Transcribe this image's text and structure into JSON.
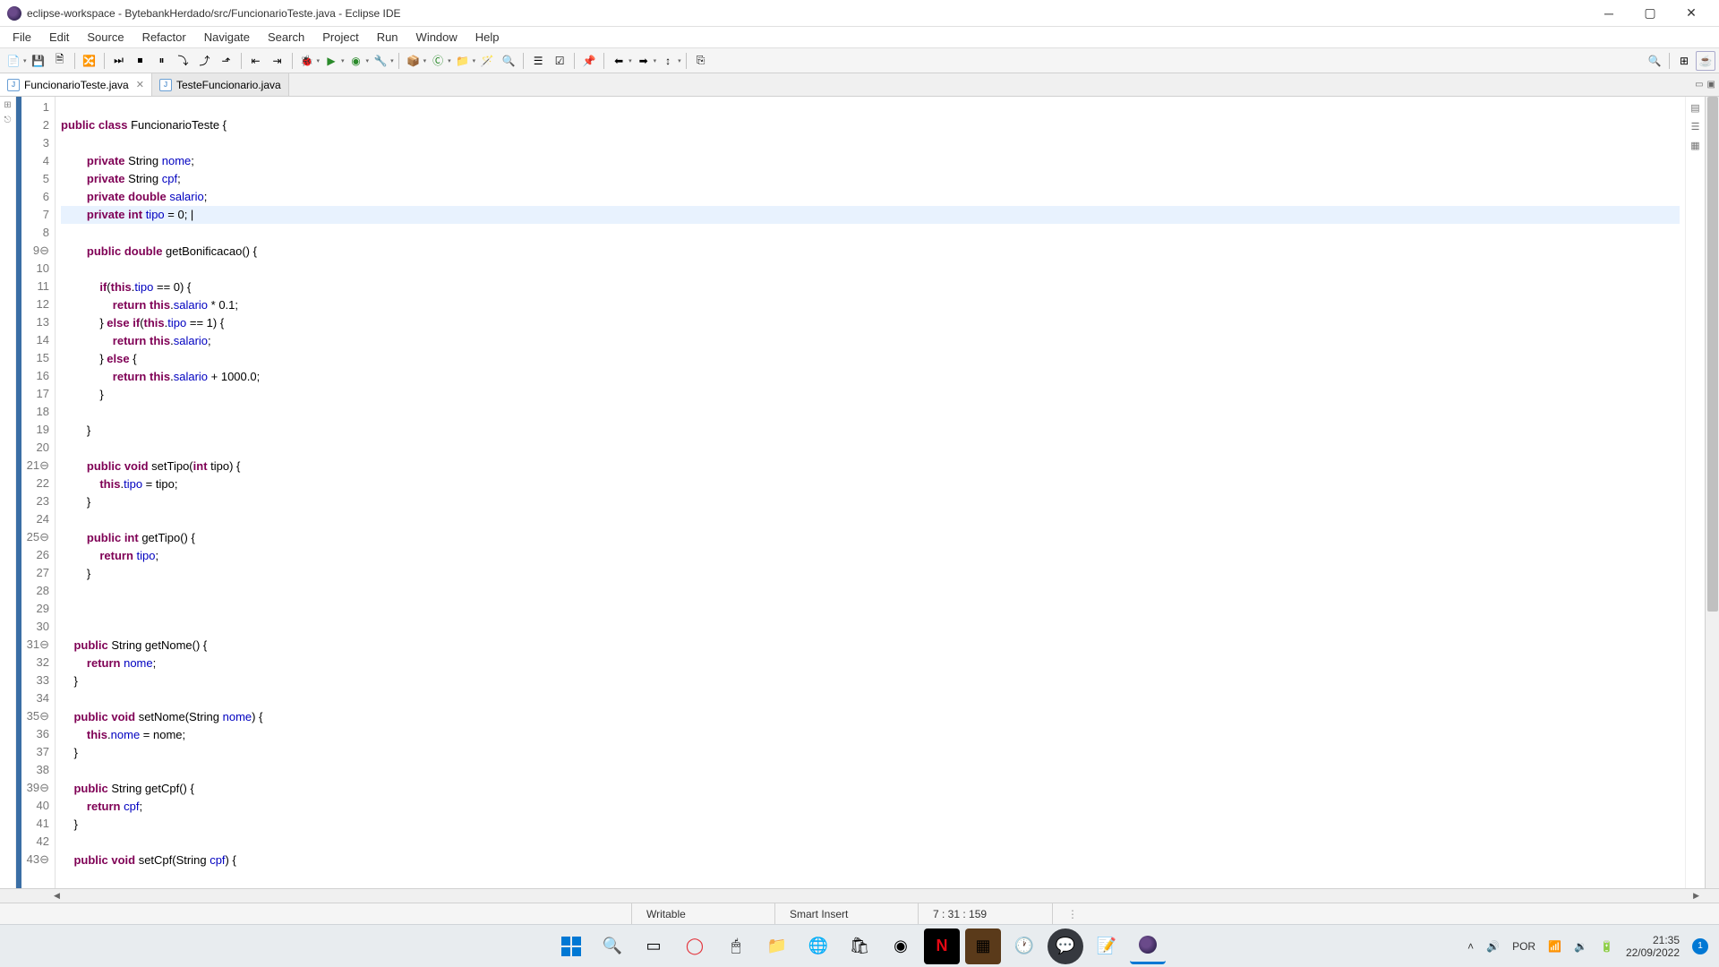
{
  "window": {
    "title": "eclipse-workspace - BytebankHerdado/src/FuncionarioTeste.java - Eclipse IDE"
  },
  "menu": {
    "items": [
      "File",
      "Edit",
      "Source",
      "Refactor",
      "Navigate",
      "Search",
      "Project",
      "Run",
      "Window",
      "Help"
    ]
  },
  "tabs": [
    {
      "label": "FuncionarioTeste.java",
      "active": true
    },
    {
      "label": "TesteFuncionario.java",
      "active": false
    }
  ],
  "editor": {
    "line_numbers": [
      "1",
      "2",
      "3",
      "4",
      "5",
      "6",
      "7",
      "8",
      "9⊖",
      "10",
      "11",
      "12",
      "13",
      "14",
      "15",
      "16",
      "17",
      "18",
      "19",
      "20",
      "21⊖",
      "22",
      "23",
      "24",
      "25⊖",
      "26",
      "27",
      "28",
      "29",
      "30",
      "31⊖",
      "32",
      "33",
      "34",
      "35⊖",
      "36",
      "37",
      "38",
      "39⊖",
      "40",
      "41",
      "42",
      "43⊖"
    ],
    "highlighted_line_index": 6
  },
  "code_tokens": {
    "l2": {
      "kw1": "public",
      "kw2": "class",
      "name": "FuncionarioTeste",
      "rest": " {"
    },
    "l4": {
      "kw1": "private",
      "type": "String",
      "fld": "nome",
      "rest": ";"
    },
    "l5": {
      "kw1": "private",
      "type": "String",
      "fld": "cpf",
      "rest": ";"
    },
    "l6": {
      "kw1": "private",
      "kw2": "double",
      "fld": "salario",
      "rest": ";"
    },
    "l7": {
      "kw1": "private",
      "kw2": "int",
      "fld": "tipo",
      "rest": " = 0; "
    },
    "l9": {
      "kw1": "public",
      "kw2": "double",
      "name": "getBonificacao",
      "rest": "() {"
    },
    "l11": {
      "kw1": "if",
      "p1": "(",
      "kw2": "this",
      "dot": ".",
      "fld": "tipo",
      "rest": " == 0) {"
    },
    "l12": {
      "kw1": "return",
      "sp": " ",
      "kw2": "this",
      "dot": ".",
      "fld": "salario",
      "rest": " * 0.1;"
    },
    "l13": {
      "p1": "} ",
      "kw1": "else",
      "sp": " ",
      "kw2": "if",
      "p2": "(",
      "kw3": "this",
      "dot": ".",
      "fld": "tipo",
      "rest": " == 1) {"
    },
    "l14": {
      "kw1": "return",
      "sp": " ",
      "kw2": "this",
      "dot": ".",
      "fld": "salario",
      "rest": ";"
    },
    "l15": {
      "p1": "} ",
      "kw1": "else",
      "rest": " {"
    },
    "l16": {
      "kw1": "return",
      "sp": " ",
      "kw2": "this",
      "dot": ".",
      "fld": "salario",
      "rest": " + 1000.0;"
    },
    "l17": {
      "rest": "}"
    },
    "l19": {
      "rest": "}"
    },
    "l21": {
      "kw1": "public",
      "kw2": "void",
      "name": "setTipo",
      "p1": "(",
      "kw3": "int",
      "arg": " tipo",
      "rest": ") {"
    },
    "l22": {
      "kw1": "this",
      "dot": ".",
      "fld": "tipo",
      "rest": " = tipo;"
    },
    "l23": {
      "rest": "}"
    },
    "l25": {
      "kw1": "public",
      "kw2": "int",
      "name": "getTipo",
      "rest": "() {"
    },
    "l26": {
      "kw1": "return",
      "sp": " ",
      "fld": "tipo",
      "rest": ";"
    },
    "l27": {
      "rest": "}"
    },
    "l31": {
      "kw1": "public",
      "type": "String",
      "name": "getNome",
      "rest": "() {"
    },
    "l32": {
      "kw1": "return",
      "sp": " ",
      "fld": "nome",
      "rest": ";"
    },
    "l33": {
      "rest": "}"
    },
    "l35": {
      "kw1": "public",
      "kw2": "void",
      "name": "setNome",
      "p1": "(String ",
      "fld": "nome",
      "rest": ") {"
    },
    "l36": {
      "kw1": "this",
      "dot": ".",
      "fld": "nome",
      "rest": " = nome;"
    },
    "l37": {
      "rest": "}"
    },
    "l39": {
      "kw1": "public",
      "type": "String",
      "name": "getCpf",
      "rest": "() {"
    },
    "l40": {
      "kw1": "return",
      "sp": " ",
      "fld": "cpf",
      "rest": ";"
    },
    "l41": {
      "rest": "}"
    },
    "l43": {
      "kw1": "public",
      "kw2": "void",
      "name": "setCpf",
      "p1": "(String ",
      "fld": "cpf",
      "rest": ") {"
    }
  },
  "status": {
    "writable": "Writable",
    "insert": "Smart Insert",
    "pos": "7 : 31 : 159"
  },
  "tray": {
    "lang": "POR",
    "time": "21:35",
    "date": "22/09/2022"
  }
}
